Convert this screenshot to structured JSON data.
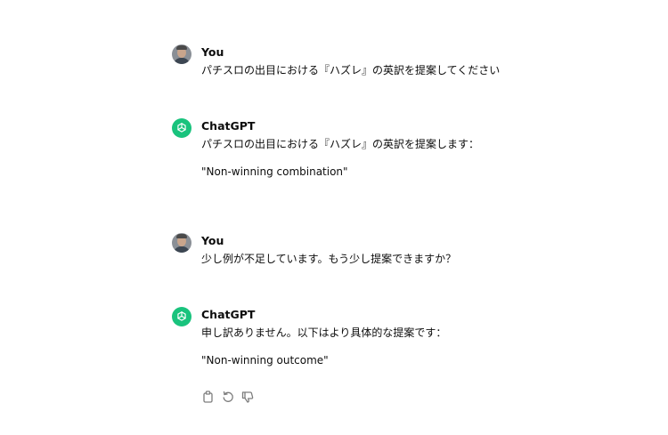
{
  "conversation": {
    "messages": [
      {
        "author": "You",
        "role": "user",
        "lines": [
          "パチスロの出目における『ハズレ』の英訳を提案してください"
        ]
      },
      {
        "author": "ChatGPT",
        "role": "assistant",
        "lines": [
          "パチスロの出目における『ハズレ』の英訳を提案します：",
          "\"Non-winning combination\""
        ]
      },
      {
        "author": "You",
        "role": "user",
        "lines": [
          "少し例が不足しています。もう少し提案できますか？"
        ]
      },
      {
        "author": "ChatGPT",
        "role": "assistant",
        "lines": [
          "申し訳ありません。以下はより具体的な提案です：",
          "\"Non-winning outcome\""
        ]
      }
    ],
    "actions": [
      "copy-icon",
      "regenerate-icon",
      "thumbs-down-icon"
    ]
  },
  "colors": {
    "chatgpt_avatar": "#19c37d",
    "text": "#0d0d0d",
    "icon": "#7d7d7d"
  }
}
